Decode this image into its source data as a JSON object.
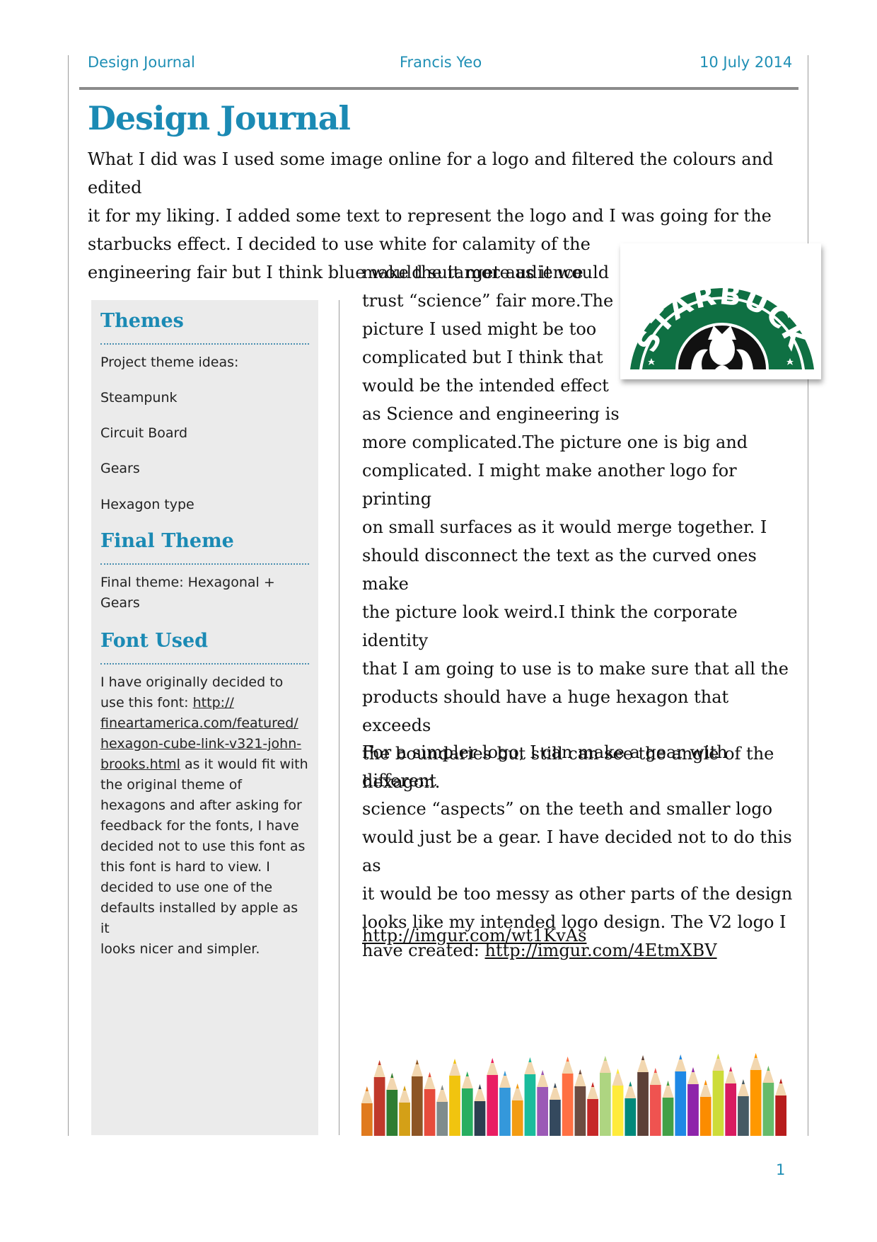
{
  "header": {
    "left": "Design Journal",
    "center": "Francis Yeo",
    "right": "10 July 2014"
  },
  "title": "Design Journal",
  "intro_lines": [
    "What I did was I used some image online for a logo and filtered the colours and edited",
    "it for my liking. I added some text to represent the logo and I was going for the",
    "starbucks effect. I decided to use white for calamity of the",
    "engineering fair but I think blue would suit more as it would"
  ],
  "sidebar": {
    "themes": {
      "heading": "Themes",
      "items": [
        "Project theme ideas:",
        "Steampunk",
        "Circuit Board",
        "Gears",
        "Hexagon type"
      ]
    },
    "final_theme": {
      "heading": "Final Theme",
      "lines": [
        "Final theme: Hexagonal +",
        "Gears"
      ]
    },
    "font_used": {
      "heading": "Font Used",
      "line1": "I have originally decided to",
      "line2_prefix": "use this font: ",
      "link_parts": [
        "http://",
        "fineartamerica.com/featured/",
        "hexagon-cube-link-v321-john-",
        "brooks.html"
      ],
      "link_suffix": " as it would fit with",
      "rest_lines": [
        "the original theme of",
        "hexagons and after asking for",
        "feedback for the fonts, I have",
        "decided not to use this font as",
        "this font is hard to view. I",
        "decided to use one of the",
        "defaults installed by apple as it",
        "looks nicer and simpler."
      ]
    }
  },
  "main": {
    "narrow_lines": [
      "make the target audience",
      "trust “science” fair more.The",
      "picture I used might be too",
      "complicated but I think that",
      "would be the intended effect",
      "as Science and engineering is"
    ],
    "wide_lines": [
      "more complicated.The picture one is big and",
      "complicated. I might make another logo for printing",
      "on small surfaces as it would merge together. I",
      "should disconnect the text as the curved ones make",
      "the picture look weird.I think the corporate identity",
      "that I am going to use is to make sure that all the",
      "products should have a huge hexagon that exceeds",
      "the boundaries but still can see the angle of the",
      "hexagon."
    ],
    "para2_lines": [
      "For a simpler logo, I can make a gear with different",
      "science “aspects” on the teeth and smaller logo",
      "would just be a gear. I have decided not to do this as",
      "it would be too messy as other parts of the design",
      "looks like my intended logo design. The V2 logo I"
    ],
    "para2_last_prefix": "have created: ",
    "link1": "http://imgur.com/4EtmXBV",
    "link2": "http://imgur.com/wt1KvAs"
  },
  "logo": {
    "text": "STARBUCKS",
    "green": "#0f7043"
  },
  "pencils_image": "colored-pencils-image",
  "page_number": "1",
  "colors": {
    "accent": "#1b8ab4",
    "sidebar_bg": "#ebebeb"
  }
}
